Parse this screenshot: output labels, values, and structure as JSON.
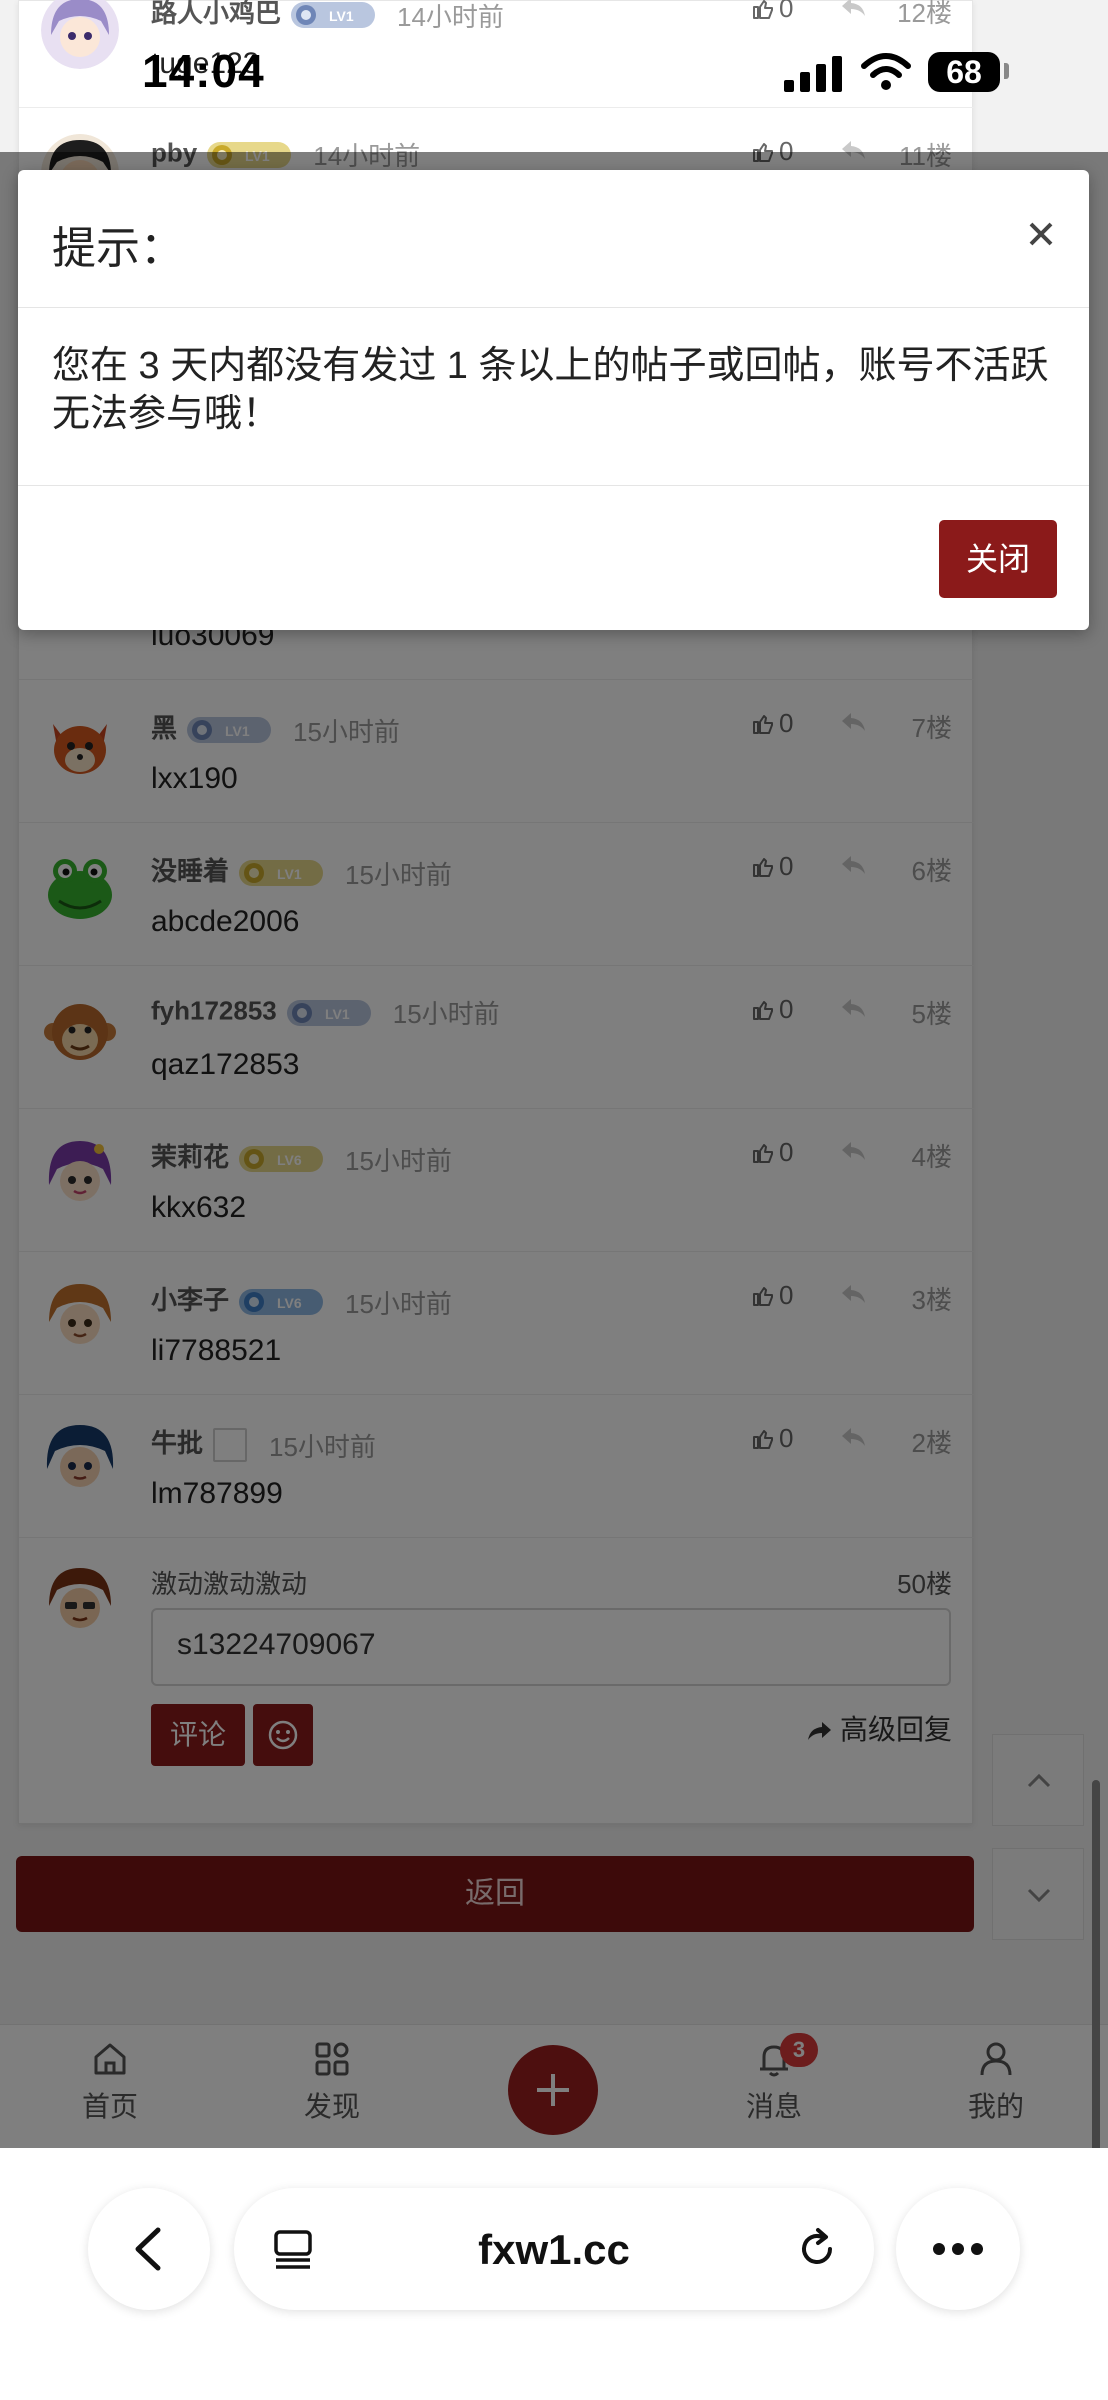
{
  "status_bar": {
    "time": "14:04",
    "battery": "68"
  },
  "thread": {
    "posts": [
      {
        "username": "路人小鸡巴",
        "time": "14小时前",
        "content": "tuge123",
        "likes": "0",
        "floor": "12楼"
      },
      {
        "username": "pby",
        "time": "14小时前",
        "content": "",
        "likes": "0",
        "floor": "11楼"
      },
      {
        "username": "",
        "time": "",
        "content": "luo30069",
        "likes": "",
        "floor": ""
      },
      {
        "username": "黑",
        "time": "15小时前",
        "content": "lxx190",
        "likes": "0",
        "floor": "7楼"
      },
      {
        "username": "没睡着",
        "time": "15小时前",
        "content": "abcde2006",
        "likes": "0",
        "floor": "6楼"
      },
      {
        "username": "fyh172853",
        "time": "15小时前",
        "content": "qaz172853",
        "likes": "0",
        "floor": "5楼"
      },
      {
        "username": "茉莉花",
        "time": "15小时前",
        "content": "kkx632",
        "likes": "0",
        "floor": "4楼"
      },
      {
        "username": "小李子",
        "time": "15小时前",
        "content": "li7788521",
        "likes": "0",
        "floor": "3楼"
      },
      {
        "username": "牛批",
        "time": "15小时前",
        "content": "lm787899",
        "likes": "0",
        "floor": "2楼"
      }
    ],
    "badges": [
      "LV1",
      "LV1",
      "LV1",
      "LV1",
      "LV1",
      "LV6"
    ],
    "reply_box": {
      "username": "激动激动激动",
      "floor": "50楼",
      "input_value": "s13224709067",
      "comment_button": "评论",
      "advanced_reply": "高级回复"
    },
    "back_button": "返回"
  },
  "bottom_nav": {
    "items": [
      {
        "label": "首页",
        "icon": "home-icon"
      },
      {
        "label": "发现",
        "icon": "grid-icon"
      },
      {
        "label": "消息",
        "icon": "bell-icon",
        "badge": "3"
      },
      {
        "label": "我的",
        "icon": "user-icon"
      }
    ]
  },
  "modal": {
    "title": "提示：",
    "message": "您在 3 天内都没有发过 1 条以上的帖子或回帖，账号不活跃无法参与哦！",
    "close_button": "关闭"
  },
  "browser": {
    "url": "fxw1.cc"
  },
  "colors": {
    "accent": "#8b1a1a",
    "badge_red": "#d83a3a",
    "overlay": "rgba(0,0,0,0.5)"
  }
}
